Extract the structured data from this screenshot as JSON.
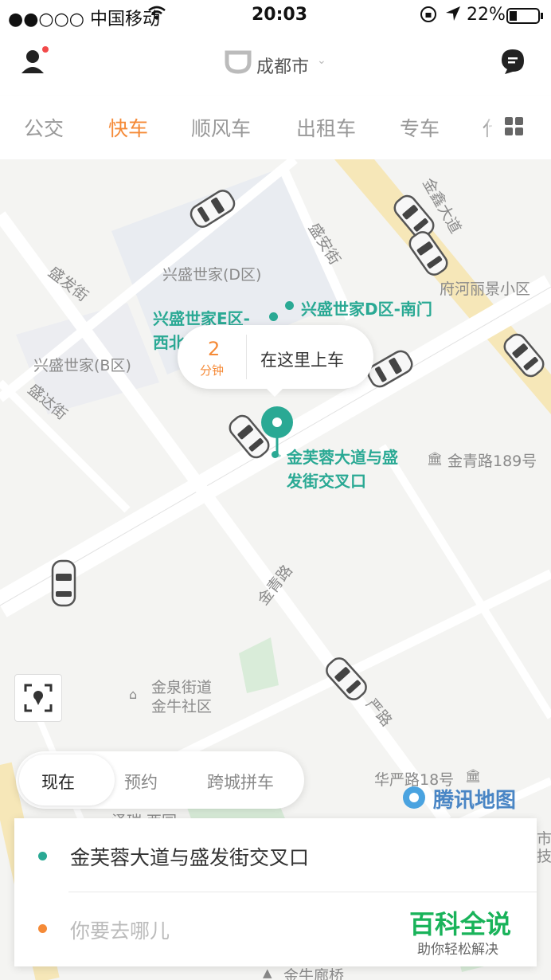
{
  "status_bar": {
    "carrier": "●●○○○ 中国移动",
    "time": "20:03",
    "battery": "22%",
    "icons": [
      "wifi-icon",
      "rotation-lock-icon",
      "location-arrow-icon",
      "battery-icon"
    ]
  },
  "header": {
    "city": "成都市",
    "icons": [
      "user-icon",
      "didi-logo-icon",
      "chevron-down-icon",
      "message-icon"
    ]
  },
  "tabs": {
    "items": [
      "公交",
      "快车",
      "顺风车",
      "出租车",
      "专车",
      "代"
    ],
    "active": "快车",
    "more_icon": "grid-icon"
  },
  "map": {
    "labels": [
      "兴盛世家(D区)",
      "盛发街",
      "盛安街",
      "金鑫大道",
      "府河丽景小区",
      "兴盛世家(B区)",
      "盛达街",
      "金青路189号",
      "金青路",
      "金泉街道",
      "金牛社区",
      "华严路18号",
      "泽瑞·西园",
      "金牛廊桥",
      "严路",
      "市",
      "技"
    ],
    "green_labels": [
      "兴盛世家E区-",
      "西北",
      "兴盛世家D区-南门",
      "金芙蓉大道与盛",
      "发街交叉口"
    ],
    "pickup": {
      "eta_minutes": "2",
      "eta_unit": "分钟",
      "text": "在这里上车"
    },
    "watermark": "腾讯地图",
    "locate_icon": "locate-icon",
    "colors": {
      "accent_green": "#2aa994",
      "accent_orange": "#f58a37"
    }
  },
  "mode": {
    "options": [
      "现在",
      "预约",
      "跨城拼车"
    ],
    "selected": "现在"
  },
  "route": {
    "from": "金芙蓉大道与盛发街交叉口",
    "to_placeholder": "你要去哪儿"
  },
  "overlay": {
    "title": "百科全说",
    "subtitle": "助你轻松解决"
  }
}
